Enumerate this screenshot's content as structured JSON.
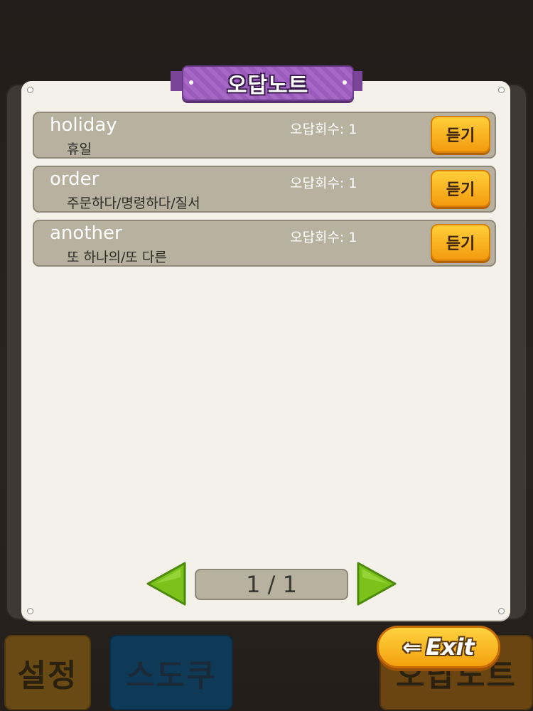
{
  "title": "오답노트",
  "rows": [
    {
      "word": "holiday",
      "meaning": "휴일",
      "count_label": "오답회수: 1",
      "listen_label": "듣기"
    },
    {
      "word": "order",
      "meaning": "주문하다/명령하다/질서",
      "count_label": "오답회수: 1",
      "listen_label": "듣기"
    },
    {
      "word": "another",
      "meaning": "또 하나의/또 다른",
      "count_label": "오답회수: 1",
      "listen_label": "듣기"
    }
  ],
  "pagination": {
    "label": "1 / 1"
  },
  "exit_label": "Exit",
  "menu": {
    "settings": "설정",
    "sudoku": "스도쿠",
    "wrong_note": "오답노트"
  },
  "colors": {
    "accent": "#f4a10f",
    "ribbon": "#9b5bbd",
    "arrow": "#7cc21a"
  },
  "icons": {
    "prev": "left-triangle-icon",
    "next": "right-triangle-icon",
    "exit": "left-arrow-icon"
  }
}
